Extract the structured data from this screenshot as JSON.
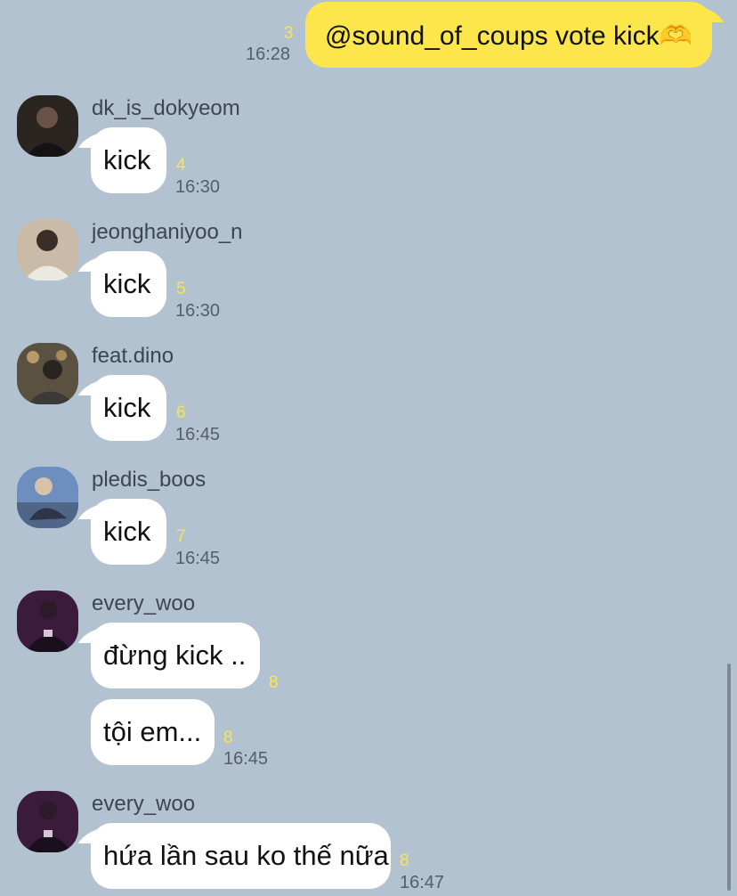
{
  "colors": {
    "background": "#b2c2d1",
    "my_bubble": "#fce64c",
    "other_bubble": "#ffffff",
    "unread": "#fce64c",
    "time": "#535f6a"
  },
  "my_message": {
    "text": "@sound_of_coups vote kick🫶",
    "unread": "3",
    "time": "16:28"
  },
  "messages": [
    {
      "sender": "dk_is_dokyeom",
      "avatar": "avatar-photo-icon",
      "text": "kick",
      "unread": "4",
      "time": "16:30"
    },
    {
      "sender": "jeonghaniyoo_n",
      "avatar": "avatar-photo-icon",
      "text": "kick",
      "unread": "5",
      "time": "16:30"
    },
    {
      "sender": "feat.dino",
      "avatar": "avatar-photo-icon",
      "text": "kick",
      "unread": "6",
      "time": "16:45"
    },
    {
      "sender": "pledis_boos",
      "avatar": "avatar-photo-icon",
      "text": "kick",
      "unread": "7",
      "time": "16:45"
    },
    {
      "sender": "every_woo",
      "avatar": "avatar-photo-icon",
      "text": "đừng kick ..",
      "unread": "8",
      "text2": "tội em...",
      "unread2": "8",
      "time": "16:45"
    },
    {
      "sender": "every_woo",
      "avatar": "avatar-photo-icon",
      "text": "hứa lần sau ko thế nữa",
      "unread": "8",
      "time": "16:47"
    }
  ]
}
